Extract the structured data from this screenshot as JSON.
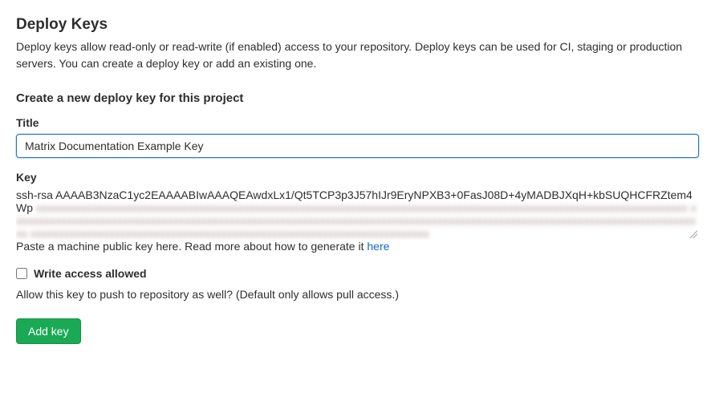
{
  "header": {
    "title": "Deploy Keys",
    "description": "Deploy keys allow read-only or read-write (if enabled) access to your repository. Deploy keys can be used for CI, staging or production servers. You can create a deploy key or add an existing one."
  },
  "form": {
    "section_title": "Create a new deploy key for this project",
    "title_field": {
      "label": "Title",
      "value": "Matrix Documentation Example Key"
    },
    "key_field": {
      "label": "Key",
      "value_visible": "ssh-rsa AAAAB3NzaC1yc2EAAAABIwAAAQEAwdxLx1/Qt5TCP3p3J57hIJr9EryNPXB3+0FasJ08D+4yMADBJXqH+kbSUQHCFRZtem4Wp",
      "value_blurred": "xxxxxxxxxxxxxxxxxxxxxxxxxxxxxxxxxxxxxxxxxxxxxxxxxxxxxxxxxxxxxxxxxxxxxxxxxxxxxxxxxxxxxxxxxxxxxxxxxxxxxxxxxxxxxxxxxxxx xxxxxxxxxxxxxxxxxxxxxxxxxxxxxxxxxxxxxxxxxxxxxxxxxxxxxxxxxxxxxxxxxxxxxxxxxxxxxxxxxxxxxxxxxxxxxxxxxxxxxxxxxxxxxxxxxxxxxxxxxxxx xxxxxxxxxxxxxxxxxxxxxxxxxxxxxxxxxxxxxxxxxxxxxxxxxxxxxxxxxxxxxxxxxxxxxxx",
      "helper_prefix": "Paste a machine public key here. Read more about how to generate it ",
      "helper_link": "here"
    },
    "write_access": {
      "label": "Write access allowed",
      "checked": false,
      "description": "Allow this key to push to repository as well? (Default only allows pull access.)"
    },
    "submit_label": "Add key"
  }
}
